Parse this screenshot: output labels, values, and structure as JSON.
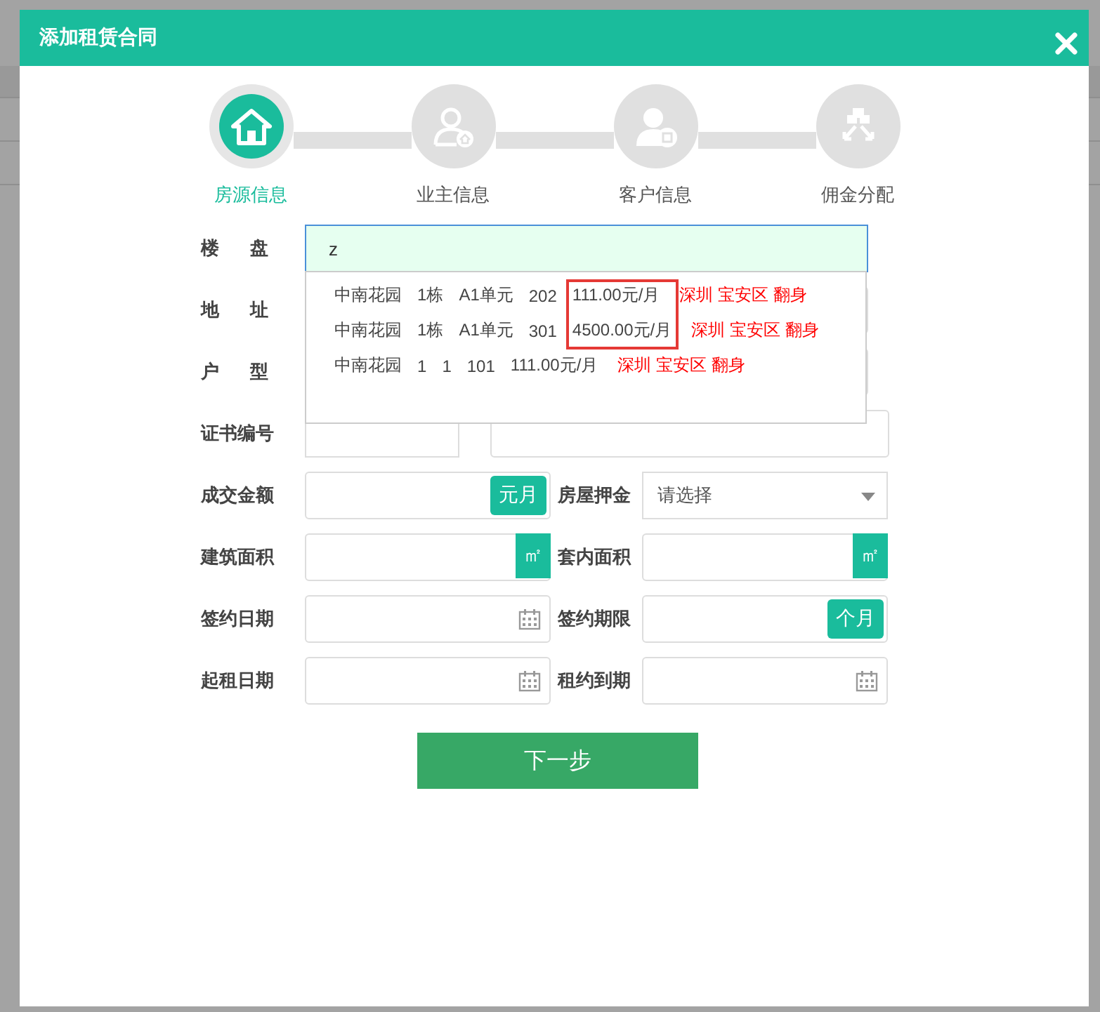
{
  "dialog": {
    "title": "添加租赁合同"
  },
  "steps": [
    {
      "label": "房源信息",
      "selected": true
    },
    {
      "label": "业主信息",
      "selected": false
    },
    {
      "label": "客户信息",
      "selected": false
    },
    {
      "label": "佣金分配",
      "selected": false
    }
  ],
  "top_fields": [
    {
      "label": "楼盘",
      "kind": "search",
      "value": "z",
      "suggestions": [
        {
          "parts": [
            "中南花园",
            "1栋",
            "A1单元",
            "202",
            "111.00元/月"
          ],
          "location": "深圳 宝安区 翻身"
        },
        {
          "parts": [
            "中南花园",
            "1栋",
            "A1单元",
            "301",
            "4500.00元/月"
          ],
          "location": "深圳 宝安区 翻身"
        },
        {
          "parts": [
            "中南花园",
            "1",
            "1",
            "101",
            "111.00元/月"
          ],
          "location": "深圳 宝安区 翻身"
        }
      ]
    },
    {
      "label": "地址",
      "kind": "text"
    },
    {
      "label": "户型",
      "kind": "text"
    },
    {
      "label": "证书编号",
      "kind": "pair"
    }
  ],
  "grid_fields": [
    {
      "label": "成交金额",
      "kind": "unit",
      "unit": "元月"
    },
    {
      "label": "房屋押金",
      "kind": "select",
      "placeholder": "请选择"
    },
    {
      "label": "建筑面积",
      "kind": "area",
      "unit": "㎡"
    },
    {
      "label": "套内面积",
      "kind": "area",
      "unit": "㎡"
    },
    {
      "label": "签约日期",
      "kind": "date"
    },
    {
      "label": "签约期限",
      "kind": "unit",
      "unit": "个月"
    },
    {
      "label": "起租日期",
      "kind": "date"
    },
    {
      "label": "租约到期",
      "kind": "date"
    }
  ],
  "next_button": "下一步"
}
